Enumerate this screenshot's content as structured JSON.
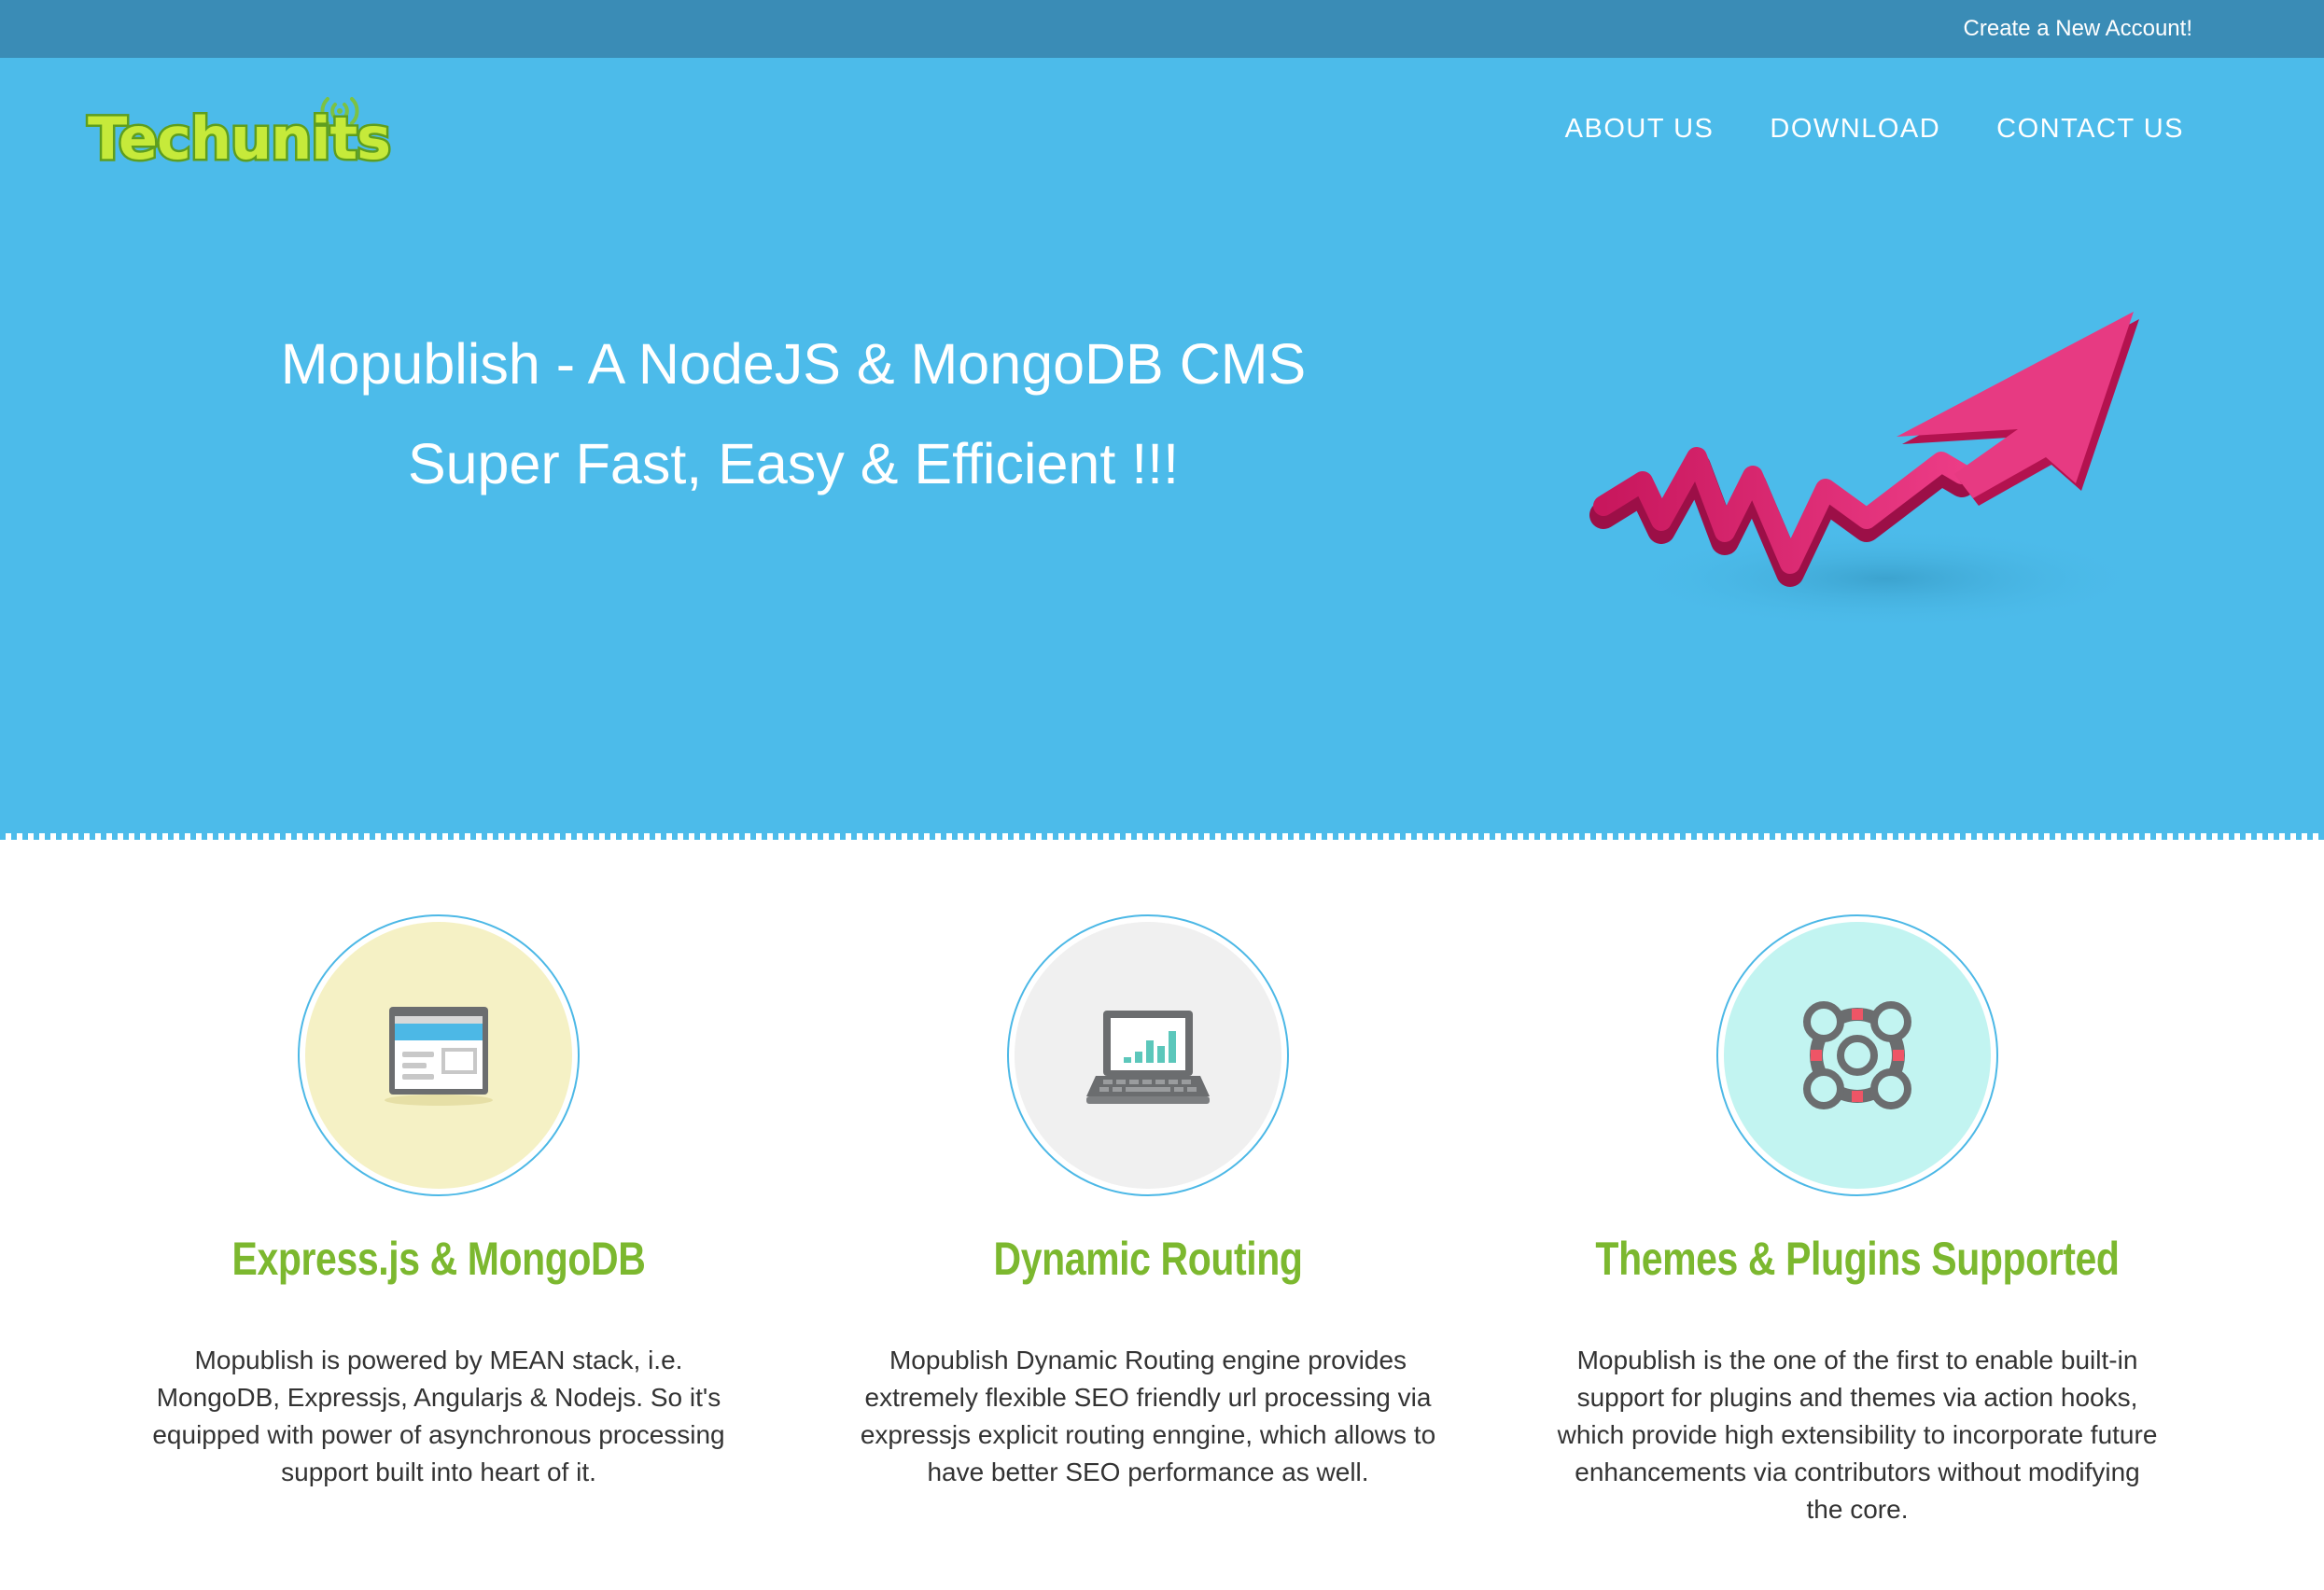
{
  "topbar": {
    "create_account": "Create a New Account!"
  },
  "header": {
    "logo_text": "Techunits",
    "nav": [
      "ABOUT US",
      "DOWNLOAD",
      "CONTACT US"
    ]
  },
  "hero": {
    "title": "Mopublish - A NodeJS & MongoDB CMS",
    "subtitle": "Super Fast, Easy & Efficient !!!"
  },
  "features": [
    {
      "icon": "browser-window-icon",
      "title": "Express.js & MongoDB",
      "description": "Mopublish is powered by MEAN stack, i.e. MongoDB, Expressjs, Angularjs & Nodejs. So it's equipped with power of asynchronous processing support built into heart of it."
    },
    {
      "icon": "laptop-chart-icon",
      "title": "Dynamic Routing",
      "description": "Mopublish Dynamic Routing engine provides extremely flexible SEO friendly url processing via expressjs explicit routing enngine, which allows to have better SEO performance as well."
    },
    {
      "icon": "lifebuoy-icon",
      "title": "Themes & Plugins Supported",
      "description": "Mopublish is the one of the first to enable built-in support for plugins and themes via action hooks, which provide high extensibility to incorporate future enhancements via contributors without modifying the core."
    }
  ],
  "colors": {
    "topbar": "#3a8cb6",
    "hero": "#4cbbea",
    "feature_title": "#7cb82f",
    "arrow": "#e0266f",
    "circle_1": "#f5f1c5",
    "circle_2": "#f0f0f0",
    "circle_3": "#c2f4f1"
  }
}
